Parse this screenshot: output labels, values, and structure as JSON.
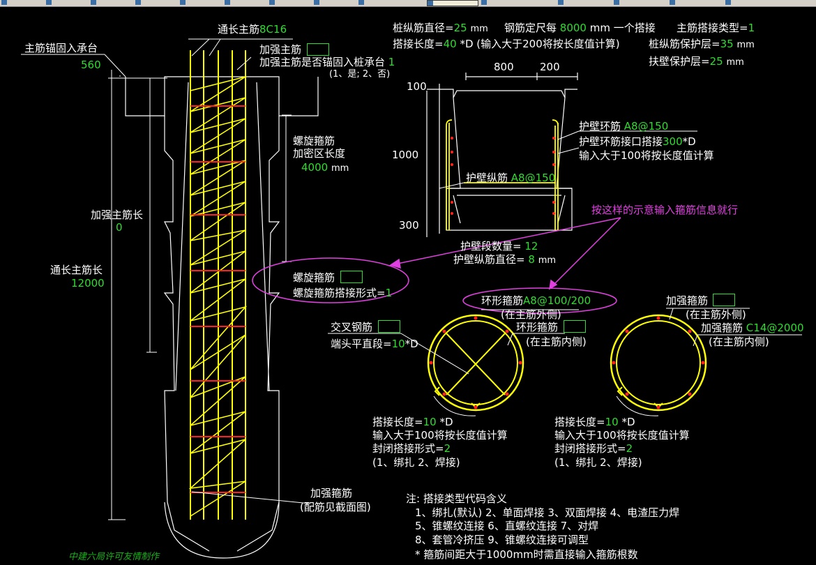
{
  "toolbar": {
    "items": [
      "",
      "",
      "",
      "",
      "",
      "",
      "",
      "",
      "",
      "",
      "",
      "",
      "",
      "",
      ""
    ]
  },
  "pile": {
    "main_bar_label": "通长主筋",
    "main_bar_value": "8C16",
    "anchor_label": "主筋锚固入承台",
    "anchor_value": "560",
    "reinforce_bar_label": "加强主筋",
    "anchor_question": "加强主筋是否锚固入桩承台",
    "anchor_answer": "1",
    "anchor_options": "(1、是; 2、否)",
    "spiral_dense_label1": "螺旋箍筋",
    "spiral_dense_label2": "加密区长度",
    "spiral_dense_value": "4000",
    "spiral_dense_unit": "mm",
    "reinforce_len_label": "加强主筋长",
    "reinforce_len_value": "0",
    "full_len_label": "通长主筋长",
    "full_len_value": "12000",
    "spiral_stirrup_label": "螺旋箍筋",
    "spiral_lap_label": "螺旋箍筋搭接形式=",
    "spiral_lap_value": "1",
    "bottom_stirrup_label1": "加强箍筋",
    "bottom_stirrup_label2": "(配筋见截面图)"
  },
  "params": {
    "diameter_label": "桩纵筋直径=",
    "diameter_value": "25",
    "diameter_unit": "mm",
    "fixed_len_label": "钢筋定尺每",
    "fixed_len_value": "8000",
    "fixed_len_unit": "mm 一个搭接",
    "lap_type_label": "主筋搭接类型=",
    "lap_type_value": "1",
    "lap_len_label": "搭接长度=",
    "lap_len_value": "40",
    "lap_len_note": "*D (输入大于200将按长度值计算)",
    "cover_label": "桩纵筋保护层=",
    "cover_value": "35",
    "cover_unit": "mm",
    "wall_cover_label": "扶壁保护层=",
    "wall_cover_value": "25",
    "wall_cover_unit": "mm"
  },
  "wall": {
    "dim_800": "800",
    "dim_200": "200",
    "dim_100": "100",
    "dim_1000": "1000",
    "dim_300": "300",
    "ring_label": "护壁环筋",
    "ring_value": "A8@150",
    "ring_lap_label": "护壁环筋接口搭接",
    "ring_lap_value": "300",
    "ring_lap_unit": "*D",
    "ring_lap_note": "输入大于100将按长度值计算",
    "long_label": "护壁纵筋",
    "long_value": "A8@150",
    "segments_label": "护壁段数量=",
    "segments_value": "12",
    "long_dia_label": "护壁纵筋直径=",
    "long_dia_value": "8",
    "long_dia_unit": "mm",
    "hint": "按这样的示意输入箍筋信息就行"
  },
  "section_left": {
    "ring_label": "环形箍筋",
    "ring_value": "A8@100/200",
    "ring_outer": "(在主筋外侧)",
    "cross_label": "交叉钢筋",
    "end_label": "端头平直段=",
    "end_value": "10",
    "end_unit": "*D",
    "inner_ring_label": "环形箍筋",
    "inner_ring_pos": "(在主筋内侧)",
    "lap_len_label": "搭接长度=",
    "lap_len_value": "10",
    "lap_len_unit": "*D",
    "lap_note": "输入大于100将按长度值计算",
    "close_label": "封闭搭接形式=",
    "close_value": "2",
    "close_options": "(1、绑扎  2、焊接)"
  },
  "section_right": {
    "stirrup_label": "加强箍筋",
    "stirrup_outer": "(在主筋外侧)",
    "stirrup2_label": "加强箍筋",
    "stirrup2_value": "C14@2000",
    "stirrup2_pos": "(在主筋内侧)",
    "lap_len_label": "搭接长度=",
    "lap_len_value": "10",
    "lap_len_unit": "*D",
    "lap_note": "输入大于100将按长度值计算",
    "close_label": "封闭搭接形式=",
    "close_value": "2",
    "close_options": "(1、绑扎  2、焊接)"
  },
  "notes": {
    "title": "注: 搭接类型代码含义",
    "line1": "1、绑扎(默认)   2、单面焊接   3、双面焊接   4、电渣压力焊",
    "line2": "5、锥螺纹连接   6、直螺纹连接   7、对焊",
    "line3": "8、套管冷挤压   9、锥螺纹连接可调型",
    "line4": "* 箍筋间距大于1000mm时需直接输入箍筋根数"
  },
  "credit": "中建六局许可友情制作",
  "colors": {
    "background": "#000000",
    "line_white": "#ffffff",
    "rebar_yellow": "#ffff00",
    "stirrup_red": "#ff2020",
    "value_green": "#2fdc2f",
    "hint_magenta": "#e040e0"
  }
}
